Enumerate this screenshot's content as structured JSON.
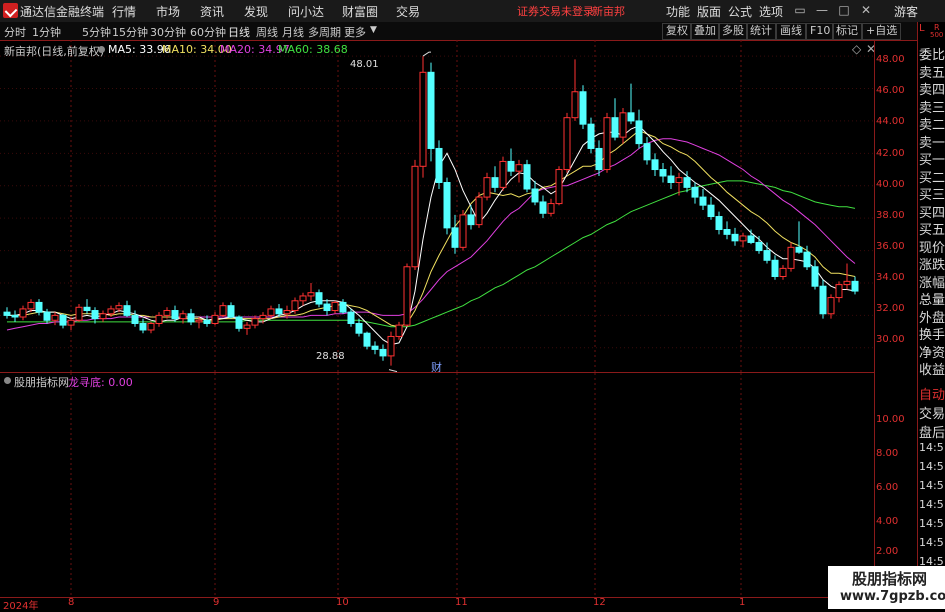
{
  "app": {
    "title": "通达信金融终端"
  },
  "menu": {
    "items": [
      "行情",
      "市场",
      "资讯",
      "发现",
      "问小达",
      "财富圈",
      "交易"
    ],
    "alert": "证券交易未登录",
    "stock_name": "新亩邦",
    "right_items": [
      "功能",
      "版面",
      "公式",
      "选项"
    ],
    "guest": "游客"
  },
  "periods": [
    "分时",
    "1分钟",
    "5分钟",
    "15分钟",
    "30分钟",
    "60分钟",
    "日线",
    "周线",
    "月线",
    "多周期",
    "更多"
  ],
  "toolbar": [
    "复权",
    "叠加",
    "多股",
    "统计",
    "画线",
    "F10",
    "标记",
    "+自选"
  ],
  "main_chart": {
    "title": "新亩邦(日线,前复权)",
    "ma": [
      {
        "label": "MA5: 33.96",
        "color": "#ffffff"
      },
      {
        "label": "MA10: 34.00",
        "color": "#f0e060"
      },
      {
        "label": "MA20: 34.97",
        "color": "#e040e0"
      },
      {
        "label": "MA60: 38.68",
        "color": "#40e040"
      }
    ],
    "high_label": "48.01",
    "low_label": "28.88",
    "marker": "财"
  },
  "sub_chart": {
    "title": "股朋指标网",
    "indicator": "龙寻底: 0.00"
  },
  "axis_main": [
    "48.00",
    "46.00",
    "44.00",
    "42.00",
    "40.00",
    "38.00",
    "36.00",
    "34.00",
    "32.00",
    "30.00"
  ],
  "axis_sub": [
    "10.00",
    "8.00",
    "6.00",
    "4.00",
    "2.00"
  ],
  "date_axis": [
    "2024年",
    "8",
    "9",
    "10",
    "11",
    "12",
    "1"
  ],
  "side_top": [
    "L",
    "R",
    "500"
  ],
  "side_labels": [
    "委比",
    "卖五",
    "卖四",
    "卖三",
    "卖二",
    "卖一",
    "买一",
    "买二",
    "买三",
    "买四",
    "买五",
    "现价",
    "涨跌",
    "涨幅",
    "总量",
    "外盘",
    "换手",
    "净资",
    "收益"
  ],
  "side_labels2": [
    "自动",
    "交易",
    "盘后",
    "14:5",
    "14:5",
    "14:5",
    "14:5",
    "14:5",
    "14:5",
    "14:5",
    "14:5",
    "14:5"
  ],
  "watermark": {
    "title": "股朋指标网",
    "url": "www.7gpzb.com"
  },
  "colors": {
    "up": "#ff3232",
    "down": "#54ffff",
    "axis": "#e03030",
    "grid": "#8a1a1a"
  },
  "chart_data": {
    "type": "candlestick",
    "ylim": [
      29,
      48.5
    ],
    "ohlc": [
      [
        32.2,
        32.5,
        31.8,
        32.0
      ],
      [
        32.0,
        32.3,
        31.6,
        31.9
      ],
      [
        31.9,
        32.6,
        31.7,
        32.4
      ],
      [
        32.4,
        33.0,
        32.2,
        32.8
      ],
      [
        32.8,
        33.0,
        32.0,
        32.2
      ],
      [
        32.2,
        32.4,
        31.5,
        31.7
      ],
      [
        31.7,
        32.2,
        31.4,
        32.0
      ],
      [
        32.0,
        32.1,
        31.2,
        31.4
      ],
      [
        31.4,
        31.9,
        31.1,
        31.7
      ],
      [
        31.7,
        32.7,
        31.6,
        32.5
      ],
      [
        32.5,
        33.0,
        32.1,
        32.3
      ],
      [
        32.3,
        32.5,
        31.5,
        31.8
      ],
      [
        31.8,
        32.3,
        31.6,
        32.1
      ],
      [
        32.1,
        32.6,
        31.9,
        32.4
      ],
      [
        32.4,
        32.8,
        32.2,
        32.6
      ],
      [
        32.6,
        32.9,
        31.9,
        32.0
      ],
      [
        32.0,
        32.3,
        31.3,
        31.5
      ],
      [
        31.5,
        31.8,
        30.9,
        31.1
      ],
      [
        31.1,
        31.6,
        30.9,
        31.5
      ],
      [
        31.5,
        32.2,
        31.3,
        32.0
      ],
      [
        32.0,
        32.5,
        31.8,
        32.3
      ],
      [
        32.3,
        32.6,
        31.6,
        31.8
      ],
      [
        31.8,
        32.3,
        31.5,
        32.1
      ],
      [
        32.1,
        32.4,
        31.4,
        31.6
      ],
      [
        31.6,
        31.9,
        31.2,
        31.7
      ],
      [
        31.7,
        32.0,
        31.3,
        31.5
      ],
      [
        31.5,
        32.2,
        31.4,
        32.0
      ],
      [
        32.0,
        32.8,
        31.9,
        32.6
      ],
      [
        32.6,
        32.8,
        31.8,
        31.9
      ],
      [
        31.9,
        32.0,
        31.0,
        31.2
      ],
      [
        31.2,
        31.6,
        30.8,
        31.4
      ],
      [
        31.4,
        32.0,
        31.2,
        31.8
      ],
      [
        31.8,
        32.2,
        31.5,
        32.0
      ],
      [
        32.0,
        32.6,
        31.8,
        32.4
      ],
      [
        32.4,
        32.7,
        31.9,
        32.1
      ],
      [
        32.1,
        32.6,
        31.8,
        32.3
      ],
      [
        32.3,
        33.1,
        32.1,
        32.9
      ],
      [
        32.9,
        33.4,
        32.6,
        33.2
      ],
      [
        33.2,
        34.0,
        32.9,
        33.4
      ],
      [
        33.4,
        33.6,
        32.5,
        32.7
      ],
      [
        32.7,
        33.0,
        32.0,
        32.3
      ],
      [
        32.3,
        32.9,
        32.1,
        32.8
      ],
      [
        32.8,
        33.0,
        32.1,
        32.2
      ],
      [
        32.2,
        32.4,
        31.3,
        31.5
      ],
      [
        31.5,
        31.8,
        30.7,
        30.9
      ],
      [
        30.9,
        31.0,
        29.9,
        30.1
      ],
      [
        30.1,
        30.4,
        29.6,
        29.9
      ],
      [
        29.9,
        30.2,
        29.2,
        29.5
      ],
      [
        29.5,
        31.0,
        28.9,
        30.7
      ],
      [
        30.7,
        31.6,
        30.5,
        31.4
      ],
      [
        31.4,
        35.2,
        31.3,
        35.0
      ],
      [
        35.0,
        41.6,
        34.8,
        41.2
      ],
      [
        41.2,
        48.0,
        40.5,
        47.0
      ],
      [
        47.0,
        47.6,
        41.5,
        42.3
      ],
      [
        42.3,
        42.8,
        39.8,
        40.2
      ],
      [
        40.2,
        40.5,
        37.0,
        37.4
      ],
      [
        37.4,
        38.2,
        35.8,
        36.2
      ],
      [
        36.2,
        38.5,
        36.0,
        38.2
      ],
      [
        38.2,
        38.8,
        37.3,
        37.6
      ],
      [
        37.6,
        39.6,
        37.4,
        39.3
      ],
      [
        39.3,
        40.8,
        39.1,
        40.5
      ],
      [
        40.5,
        41.2,
        39.6,
        39.9
      ],
      [
        39.9,
        41.8,
        39.7,
        41.5
      ],
      [
        41.5,
        42.3,
        40.6,
        40.9
      ],
      [
        40.9,
        41.6,
        40.2,
        41.3
      ],
      [
        41.3,
        41.6,
        39.6,
        39.8
      ],
      [
        39.8,
        40.3,
        38.8,
        39.0
      ],
      [
        39.0,
        39.4,
        38.0,
        38.3
      ],
      [
        38.3,
        39.2,
        38.1,
        38.9
      ],
      [
        38.9,
        41.2,
        38.8,
        41.0
      ],
      [
        41.0,
        44.5,
        40.8,
        44.2
      ],
      [
        44.2,
        47.8,
        44.0,
        45.8
      ],
      [
        45.8,
        46.2,
        43.5,
        43.8
      ],
      [
        43.8,
        44.2,
        42.0,
        42.3
      ],
      [
        42.3,
        42.8,
        40.6,
        41.0
      ],
      [
        41.0,
        44.5,
        40.8,
        44.2
      ],
      [
        44.2,
        45.4,
        42.8,
        43.0
      ],
      [
        43.0,
        44.8,
        42.6,
        44.5
      ],
      [
        44.5,
        46.3,
        43.8,
        44.0
      ],
      [
        44.0,
        44.7,
        42.3,
        42.6
      ],
      [
        42.6,
        43.0,
        41.3,
        41.6
      ],
      [
        41.6,
        42.0,
        40.6,
        41.0
      ],
      [
        41.0,
        41.4,
        40.2,
        40.6
      ],
      [
        40.6,
        41.2,
        39.8,
        40.2
      ],
      [
        40.2,
        40.8,
        39.4,
        40.5
      ],
      [
        40.5,
        40.9,
        39.6,
        39.9
      ],
      [
        39.9,
        40.2,
        38.9,
        39.3
      ],
      [
        39.3,
        39.8,
        38.5,
        38.8
      ],
      [
        38.8,
        39.3,
        37.9,
        38.1
      ],
      [
        38.1,
        38.4,
        37.0,
        37.3
      ],
      [
        37.3,
        37.8,
        36.7,
        37.0
      ],
      [
        37.0,
        37.4,
        36.3,
        36.6
      ],
      [
        36.6,
        37.1,
        36.2,
        36.9
      ],
      [
        36.9,
        37.3,
        36.4,
        36.5
      ],
      [
        36.5,
        36.9,
        35.8,
        36.0
      ],
      [
        36.0,
        36.5,
        35.2,
        35.4
      ],
      [
        35.4,
        35.7,
        34.2,
        34.4
      ],
      [
        34.4,
        35.1,
        34.2,
        34.9
      ],
      [
        34.9,
        36.5,
        34.7,
        36.2
      ],
      [
        36.2,
        37.8,
        35.8,
        35.9
      ],
      [
        35.9,
        36.3,
        34.8,
        35.0
      ],
      [
        35.0,
        35.4,
        33.6,
        33.8
      ],
      [
        33.8,
        34.2,
        31.8,
        32.1
      ],
      [
        32.1,
        33.3,
        31.8,
        33.1
      ],
      [
        33.1,
        34.1,
        32.8,
        33.9
      ],
      [
        33.9,
        35.2,
        33.6,
        34.1
      ],
      [
        34.1,
        34.4,
        33.3,
        33.5
      ]
    ],
    "ma5": [
      32.0,
      32.0,
      32.1,
      32.3,
      32.3,
      32.2,
      32.2,
      32.0,
      31.8,
      31.9,
      32.0,
      31.9,
      32.0,
      32.1,
      32.3,
      32.2,
      32.1,
      31.9,
      31.7,
      31.6,
      31.7,
      31.7,
      31.9,
      31.9,
      31.9,
      31.7,
      31.8,
      31.8,
      31.9,
      31.8,
      31.7,
      31.6,
      31.6,
      31.8,
      32.0,
      32.1,
      32.3,
      32.6,
      32.8,
      32.9,
      32.9,
      32.9,
      32.8,
      32.4,
      32.0,
      31.5,
      31.0,
      30.5,
      30.2,
      30.3,
      31.3,
      33.5,
      36.7,
      39.3,
      41.2,
      42.0,
      41.0,
      39.7,
      38.7,
      37.7,
      38.3,
      39.1,
      39.8,
      40.4,
      40.8,
      40.7,
      40.2,
      39.9,
      39.5,
      39.8,
      40.7,
      41.6,
      42.5,
      42.9,
      43.2,
      43.3,
      43.3,
      43.1,
      43.5,
      43.7,
      43.2,
      42.7,
      42.1,
      41.6,
      41.0,
      40.6,
      40.2,
      39.9,
      39.5,
      39.1,
      38.6,
      38.1,
      37.6,
      37.1,
      36.7,
      36.2,
      35.8,
      35.5,
      35.5,
      35.4,
      35.3,
      34.9,
      34.2,
      33.8,
      33.6,
      33.6,
      33.5
    ],
    "ma10": [
      32.0,
      32.0,
      32.0,
      32.1,
      32.2,
      32.2,
      32.2,
      32.1,
      32.0,
      32.1,
      32.1,
      32.1,
      32.1,
      32.0,
      32.1,
      32.1,
      32.0,
      32.0,
      31.9,
      31.9,
      31.9,
      31.9,
      31.8,
      31.8,
      31.8,
      31.7,
      31.7,
      31.8,
      31.8,
      31.8,
      31.8,
      31.8,
      31.8,
      31.8,
      31.9,
      32.0,
      32.0,
      32.1,
      32.3,
      32.4,
      32.5,
      32.6,
      32.7,
      32.6,
      32.5,
      32.3,
      32.0,
      31.7,
      31.4,
      31.3,
      31.5,
      32.3,
      33.4,
      34.7,
      35.7,
      36.6,
      37.5,
      38.1,
      38.9,
      39.4,
      39.6,
      39.5,
      39.4,
      39.5,
      39.3,
      39.5,
      39.6,
      39.9,
      40.0,
      40.3,
      40.6,
      40.9,
      41.2,
      41.2,
      41.4,
      41.9,
      42.2,
      42.6,
      43.0,
      43.4,
      43.2,
      43.0,
      42.6,
      42.4,
      42.1,
      41.9,
      41.5,
      41.0,
      40.5,
      40.1,
      39.6,
      39.2,
      38.8,
      38.4,
      38.1,
      37.7,
      37.2,
      36.8,
      36.5,
      36.3,
      36.0,
      35.6,
      35.0,
      34.6,
      34.6,
      34.5,
      34.4
    ],
    "ma20": [
      31.1,
      31.2,
      31.3,
      31.4,
      31.5,
      31.5,
      31.6,
      31.6,
      31.6,
      31.7,
      31.7,
      31.8,
      31.8,
      31.8,
      31.9,
      31.9,
      31.9,
      31.9,
      31.9,
      31.9,
      31.9,
      31.9,
      31.9,
      31.9,
      31.9,
      31.9,
      31.9,
      31.9,
      31.9,
      31.9,
      31.9,
      31.9,
      31.9,
      31.9,
      31.9,
      31.9,
      31.9,
      31.9,
      32.0,
      32.0,
      32.0,
      32.1,
      32.1,
      32.2,
      32.2,
      32.2,
      32.1,
      32.0,
      32.0,
      32.0,
      32.1,
      32.5,
      33.0,
      33.6,
      34.2,
      34.7,
      35.0,
      35.3,
      35.6,
      36.1,
      36.6,
      37.2,
      37.8,
      38.3,
      38.6,
      39.1,
      39.6,
      39.8,
      39.9,
      40.0,
      40.0,
      40.2,
      40.4,
      40.6,
      40.8,
      41.1,
      41.3,
      41.6,
      41.9,
      42.3,
      42.6,
      42.8,
      42.9,
      42.9,
      42.8,
      42.7,
      42.5,
      42.3,
      42.1,
      41.9,
      41.6,
      41.3,
      41.0,
      40.6,
      40.3,
      39.9,
      39.5,
      39.1,
      38.8,
      38.4,
      38.0,
      37.6,
      37.1,
      36.6,
      36.1,
      35.6,
      35.2
    ],
    "ma60": [
      31.6,
      31.6,
      31.6,
      31.6,
      31.6,
      31.6,
      31.6,
      31.6,
      31.6,
      31.6,
      31.6,
      31.6,
      31.6,
      31.6,
      31.6,
      31.6,
      31.6,
      31.6,
      31.6,
      31.6,
      31.6,
      31.6,
      31.6,
      31.6,
      31.6,
      31.6,
      31.6,
      31.6,
      31.6,
      31.6,
      31.7,
      31.7,
      31.7,
      31.7,
      31.7,
      31.7,
      31.7,
      31.7,
      31.7,
      31.7,
      31.7,
      31.7,
      31.7,
      31.7,
      31.7,
      31.6,
      31.5,
      31.4,
      31.3,
      31.3,
      31.3,
      31.4,
      31.6,
      31.8,
      32.0,
      32.2,
      32.4,
      32.6,
      32.9,
      33.1,
      33.4,
      33.7,
      33.9,
      34.2,
      34.5,
      34.8,
      35.0,
      35.3,
      35.6,
      35.9,
      36.2,
      36.5,
      36.8,
      37.0,
      37.3,
      37.6,
      37.8,
      38.1,
      38.4,
      38.6,
      38.8,
      39.0,
      39.2,
      39.4,
      39.6,
      39.7,
      39.9,
      40.0,
      40.1,
      40.2,
      40.3,
      40.3,
      40.3,
      40.2,
      40.1,
      40.0,
      39.9,
      39.7,
      39.6,
      39.4,
      39.2,
      39.0,
      38.9,
      38.8,
      38.7,
      38.7,
      38.6
    ]
  }
}
